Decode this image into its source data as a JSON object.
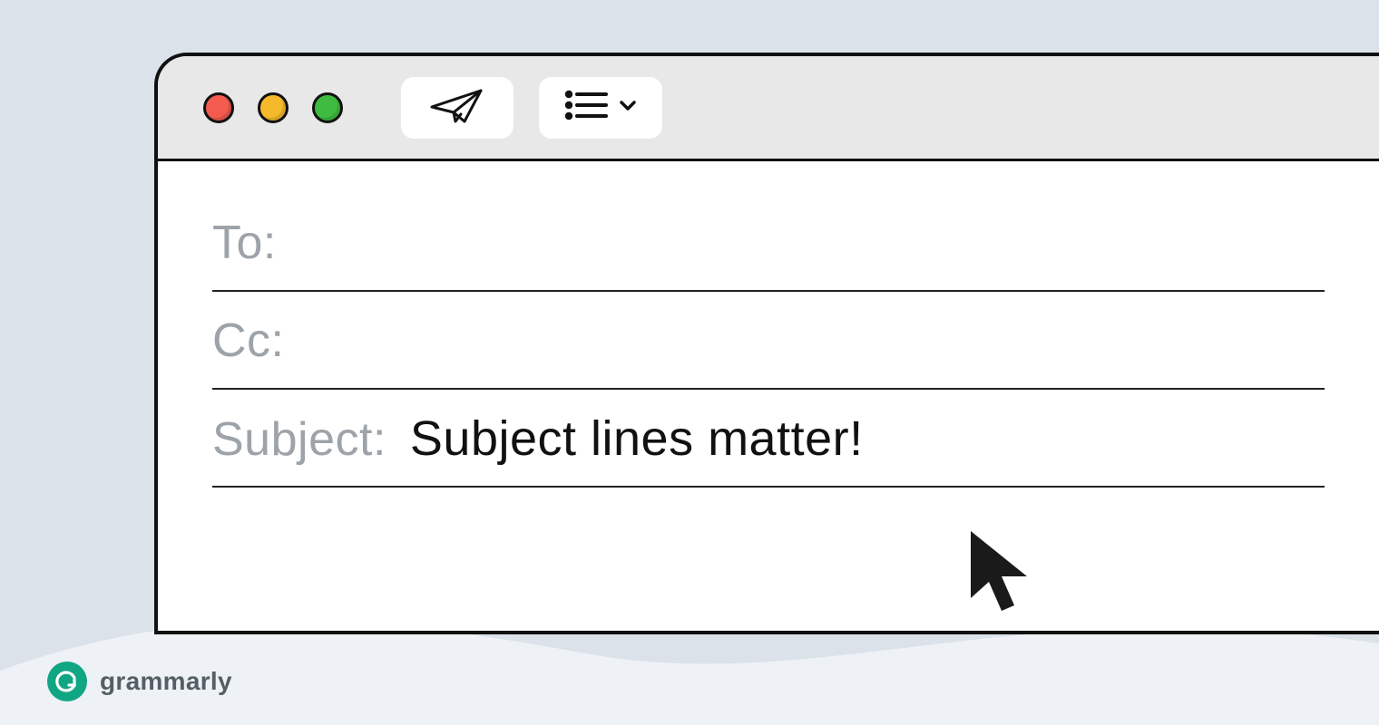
{
  "toolbar": {
    "traffic": {
      "red": "#f25b4e",
      "yellow": "#f5b92c",
      "green": "#3fbb3f"
    },
    "send_icon": "paper-plane-icon",
    "list_icon": "list-icon"
  },
  "compose": {
    "to": {
      "label": "To:",
      "value": ""
    },
    "cc": {
      "label": "Cc:",
      "value": ""
    },
    "subject": {
      "label": "Subject:",
      "value": "Subject lines matter!"
    }
  },
  "brand": {
    "name": "grammarly",
    "logo_letter": "G"
  },
  "colors": {
    "page_bg": "#dbe2ea",
    "titlebar": "#e8e8e8",
    "accent": "#11a683"
  }
}
